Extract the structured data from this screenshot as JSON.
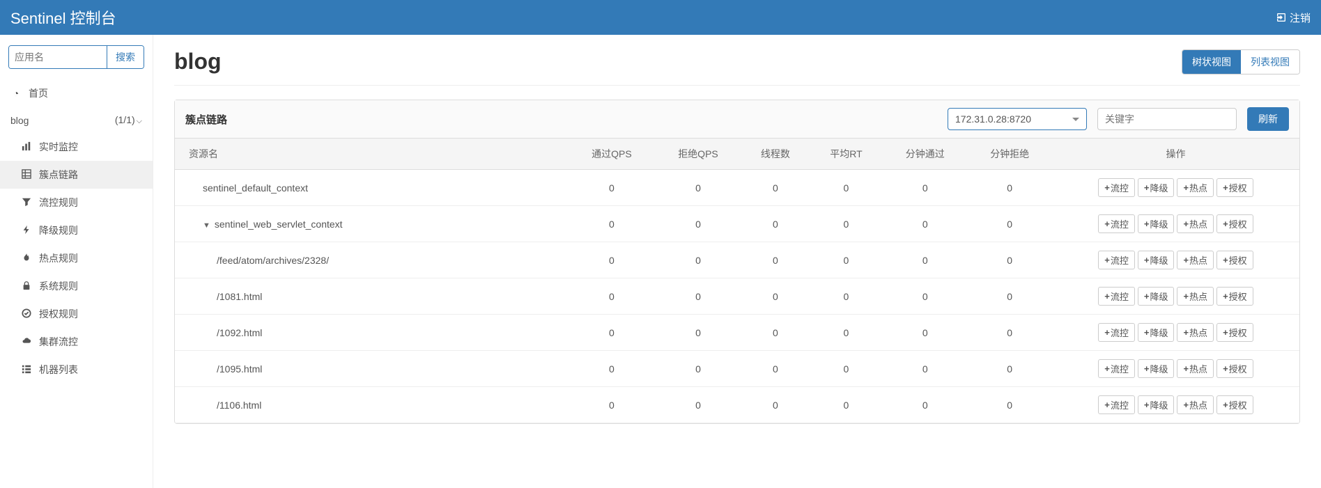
{
  "header": {
    "title": "Sentinel 控制台",
    "logout": "注销"
  },
  "sidebar": {
    "search_placeholder": "应用名",
    "search_btn": "搜索",
    "home": "首页",
    "app_name": "blog",
    "app_count": "(1/1)",
    "menu": [
      {
        "label": "实时监控",
        "icon": "chart"
      },
      {
        "label": "簇点链路",
        "icon": "list",
        "active": true
      },
      {
        "label": "流控规则",
        "icon": "filter"
      },
      {
        "label": "降级规则",
        "icon": "bolt"
      },
      {
        "label": "热点规则",
        "icon": "fire"
      },
      {
        "label": "系统规则",
        "icon": "lock"
      },
      {
        "label": "授权规则",
        "icon": "check"
      },
      {
        "label": "集群流控",
        "icon": "cloud"
      },
      {
        "label": "机器列表",
        "icon": "bars"
      }
    ]
  },
  "main": {
    "title": "blog",
    "view_tree": "树状视图",
    "view_list": "列表视图",
    "panel_title": "簇点链路",
    "machine": "172.31.0.28:8720",
    "keyword_placeholder": "关键字",
    "refresh": "刷新",
    "columns": [
      "资源名",
      "通过QPS",
      "拒绝QPS",
      "线程数",
      "平均RT",
      "分钟通过",
      "分钟拒绝",
      "操作"
    ],
    "actions": {
      "flow": "流控",
      "degrade": "降级",
      "hotspot": "热点",
      "auth": "授权"
    },
    "rows": [
      {
        "name": "sentinel_default_context",
        "indent": 0,
        "expand": null,
        "passQps": 0,
        "blockQps": 0,
        "threads": 0,
        "avgRt": 0,
        "minPass": 0,
        "minBlock": 0
      },
      {
        "name": "sentinel_web_servlet_context",
        "indent": 0,
        "expand": "▼",
        "passQps": 0,
        "blockQps": 0,
        "threads": 0,
        "avgRt": 0,
        "minPass": 0,
        "minBlock": 0
      },
      {
        "name": "/feed/atom/archives/2328/",
        "indent": 1,
        "expand": null,
        "passQps": 0,
        "blockQps": 0,
        "threads": 0,
        "avgRt": 0,
        "minPass": 0,
        "minBlock": 0
      },
      {
        "name": "/1081.html",
        "indent": 1,
        "expand": null,
        "passQps": 0,
        "blockQps": 0,
        "threads": 0,
        "avgRt": 0,
        "minPass": 0,
        "minBlock": 0
      },
      {
        "name": "/1092.html",
        "indent": 1,
        "expand": null,
        "passQps": 0,
        "blockQps": 0,
        "threads": 0,
        "avgRt": 0,
        "minPass": 0,
        "minBlock": 0
      },
      {
        "name": "/1095.html",
        "indent": 1,
        "expand": null,
        "passQps": 0,
        "blockQps": 0,
        "threads": 0,
        "avgRt": 0,
        "minPass": 0,
        "minBlock": 0
      },
      {
        "name": "/1106.html",
        "indent": 1,
        "expand": null,
        "passQps": 0,
        "blockQps": 0,
        "threads": 0,
        "avgRt": 0,
        "minPass": 0,
        "minBlock": 0
      }
    ]
  },
  "icons": {
    "chart": "📊",
    "list": "▦",
    "filter": "▼",
    "bolt": "⚡",
    "fire": "🔥",
    "lock": "🔒",
    "check": "✔",
    "cloud": "☁",
    "bars": "≡",
    "clock": "◔"
  }
}
